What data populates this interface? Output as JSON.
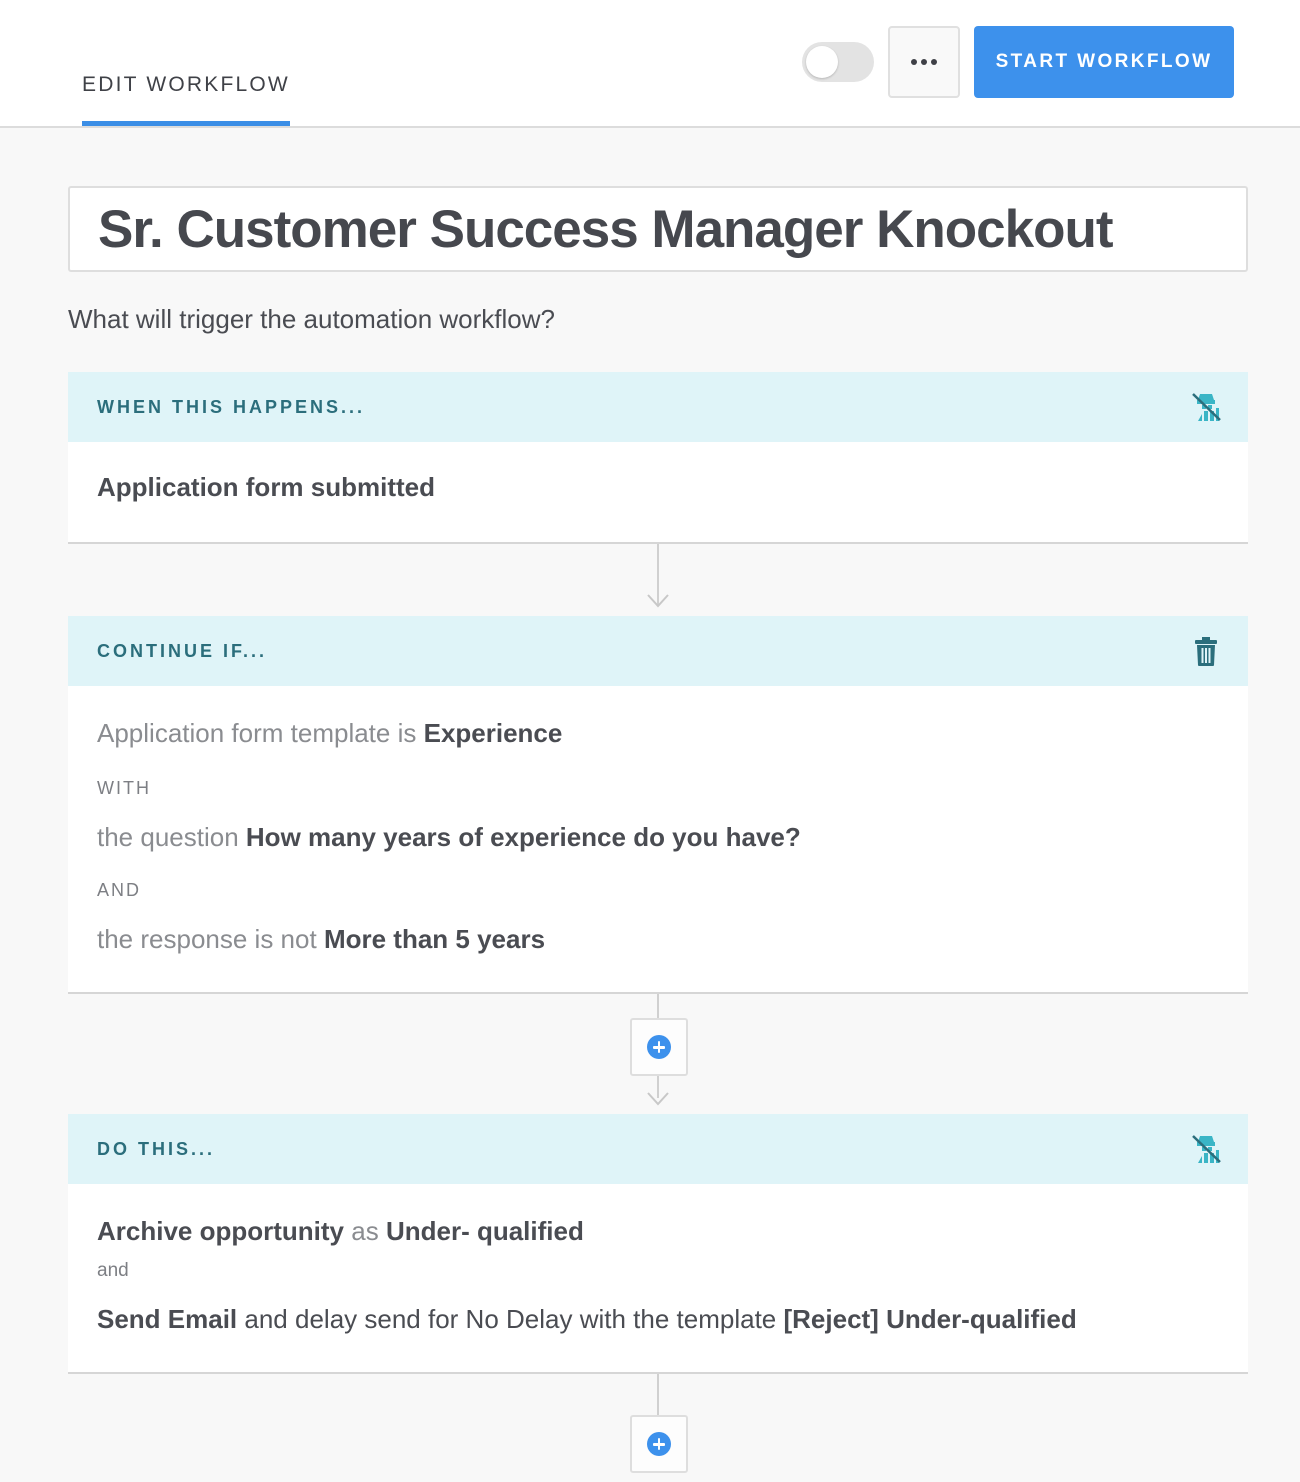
{
  "header": {
    "tab_label": "EDIT WORKFLOW",
    "start_label": "START WORKFLOW",
    "toggle_on": false
  },
  "workflow": {
    "title": "Sr. Customer Success Manager Knockout",
    "prompt": "What will trigger the automation workflow?"
  },
  "trigger": {
    "heading": "WHEN THIS HAPPENS...",
    "icon": "eraser-icon",
    "value": "Application form submitted"
  },
  "condition": {
    "heading": "CONTINUE IF...",
    "icon": "trash-icon",
    "line1_prefix": "Application form template is",
    "line1_value": "Experience",
    "with_label": "WITH",
    "line2_prefix": "the question",
    "line2_value": "How many years of experience do you have?",
    "and_label": "AND",
    "line3_prefix": "the response is not",
    "line3_value": "More than 5 years"
  },
  "action": {
    "heading": "DO THIS...",
    "icon": "eraser-icon",
    "line1_action": "Archive opportunity",
    "line1_as": "as",
    "line1_value": "Under- qualified",
    "and_label": "and",
    "line2_action": "Send Email",
    "line2_middle": "and delay send for No Delay with the template",
    "line2_value": "[Reject] Under-qualified"
  },
  "colors": {
    "accent": "#3d91ec",
    "section_header_bg": "#dff4f8",
    "section_header_text": "#2b6e7c"
  }
}
